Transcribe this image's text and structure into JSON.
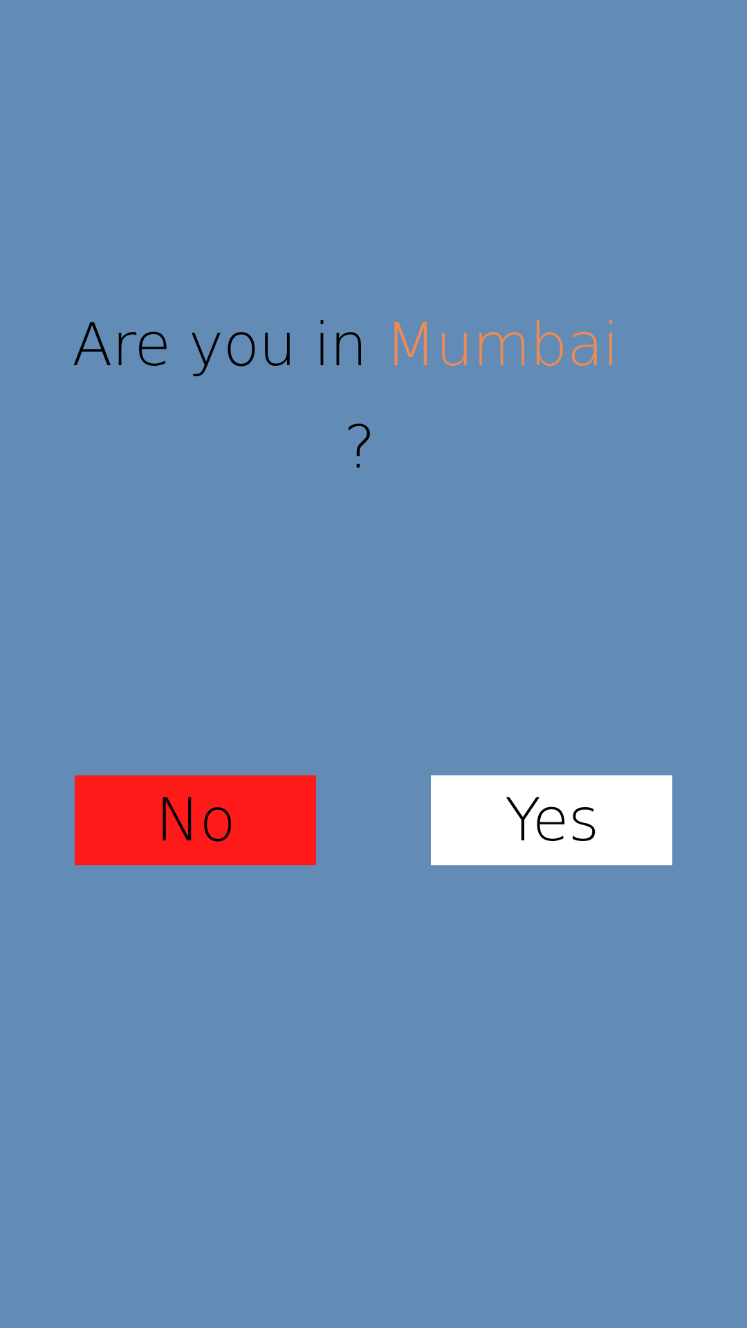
{
  "prompt": {
    "text_before": "Are you in ",
    "city": "Mumbai",
    "question_mark": "?"
  },
  "buttons": {
    "no_label": "No",
    "yes_label": "Yes"
  },
  "colors": {
    "background": "#628cb6",
    "city_accent": "#f08a55",
    "no_button": "#ff1a1a",
    "yes_button": "#ffffff",
    "text": "#000000"
  }
}
